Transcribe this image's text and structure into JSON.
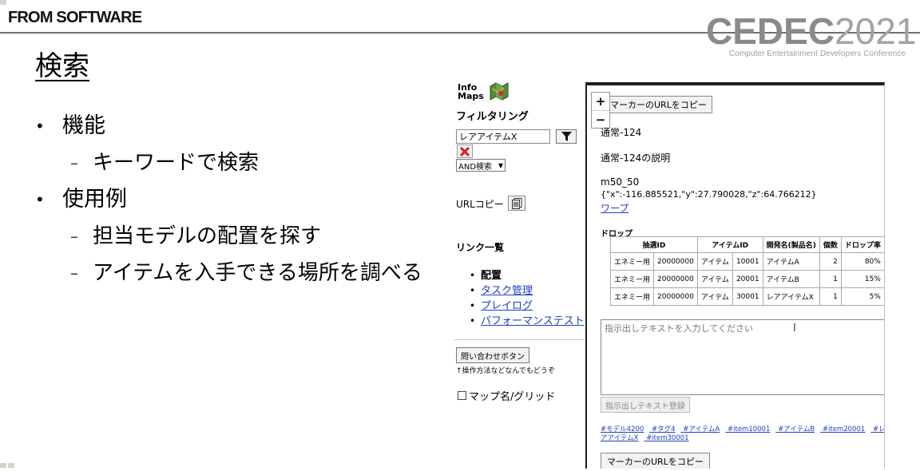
{
  "header": {
    "brand": "FROM SOFTWARE",
    "cedec_main": "CEDEC",
    "cedec_year": "2021",
    "cedec_sub": "Computer Entertainment Developers Conference"
  },
  "slide": {
    "title": "検索",
    "bullets": [
      {
        "text": "機能",
        "subs": [
          "キーワードで検索"
        ]
      },
      {
        "text": "使用例",
        "subs": [
          "担当モデルの配置を探す",
          "アイテムを入手できる場所を調べる"
        ]
      }
    ]
  },
  "sidebar": {
    "logo_line1": "Info",
    "logo_line2": "Maps",
    "filter_heading": "フィルタリング",
    "filter_value": "レアアイテムX",
    "and_select": "AND検索",
    "url_copy_label": "URLコピー",
    "links_heading": "リンク一覧",
    "links": [
      {
        "label": "配置",
        "current": true
      },
      {
        "label": "タスク管理",
        "current": false
      },
      {
        "label": "プレイログ",
        "current": false
      },
      {
        "label": "パフォーマンステスト",
        "current": false
      }
    ],
    "inquiry_button": "問い合わせボタン",
    "inquiry_note": "↑操作方法などなんでもどうぞ",
    "map_grid_label": "マップ名/グリッド"
  },
  "popup": {
    "zoom_in": "+",
    "zoom_out": "−",
    "copy_marker_url": "マーカーのURLをコピー",
    "name": "通常-124",
    "description": "通常-124の説明",
    "model": "m50_50",
    "coords": "{\"x\":-116.885521,\"y\":27.790028,\"z\":64.766212}",
    "warp_link": "ワープ",
    "drop_heading": "ドロップ",
    "table": {
      "headers": [
        "抽選ID",
        "アイテムID",
        "開発名(製品名)",
        "個数",
        "ドロップ率"
      ],
      "rows": [
        [
          "エネミー用",
          "20000000",
          "アイテム",
          "10001",
          "アイテムA",
          "2",
          "80%"
        ],
        [
          "エネミー用",
          "20000000",
          "アイテム",
          "20001",
          "アイテムB",
          "1",
          "15%"
        ],
        [
          "エネミー用",
          "20000000",
          "アイテム",
          "30001",
          "レアアイテムX",
          "1",
          "5%"
        ]
      ]
    },
    "text_placeholder": "指示出しテキストを入力してください",
    "register_button": "指示出しテキスト登録",
    "tags": [
      "#モデル4200",
      "#タグ4",
      "#アイテムA",
      "#item10001",
      "#アイテムB",
      "#item20001",
      "#レアアイテムX",
      "#item30001"
    ]
  },
  "colors": {
    "link": "#1f3fbf",
    "rule": "#6f6f6f",
    "cedec_gray": "#8a8a8a",
    "clear_red": "#d42020"
  },
  "icons": {
    "filter": "funnel-icon",
    "clear": "x-icon",
    "copy": "clipboard-icon",
    "logo": "map-icon"
  }
}
